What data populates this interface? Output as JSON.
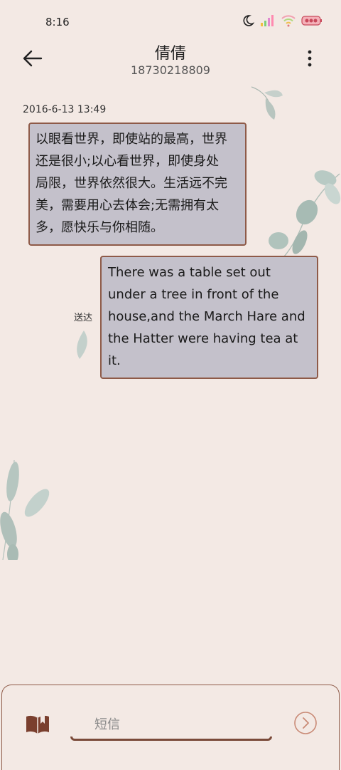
{
  "status_bar": {
    "time": "8:16",
    "icons": [
      "moon-icon",
      "signal-icon",
      "wifi-icon",
      "battery-icon"
    ]
  },
  "header": {
    "contact_name": "倩倩",
    "phone_number": "18730218809",
    "back_icon": "arrow-left-icon",
    "more_icon": "more-vertical-icon"
  },
  "conversation": {
    "timestamp": "2016-6-13 13:49",
    "messages": [
      {
        "direction": "incoming",
        "lines": [
          "以眼看世界，即使站的最高，世界",
          "还是很小;以心看世界，即使身处",
          "局限，世界依然很大。生活远不完",
          "美，需要用心去体会;无需拥有太",
          "多，愿快乐与你相随。"
        ]
      },
      {
        "direction": "outgoing",
        "lines": [
          "There was a table set out",
          "under a tree in front of the",
          "house,and the March Hare and",
          "the Hatter were having tea at",
          "it."
        ],
        "status": "送达"
      }
    ]
  },
  "composer": {
    "placeholder": "短信",
    "value": "",
    "attach_icon": "book-icon",
    "send_icon": "send-arrow-icon"
  },
  "colors": {
    "background": "#f3e9e4",
    "bubble_fill": "#c4c1cb",
    "bubble_border": "#8e5a48",
    "accent_brown": "#7a4a39",
    "send_icon": "#c98a76"
  }
}
